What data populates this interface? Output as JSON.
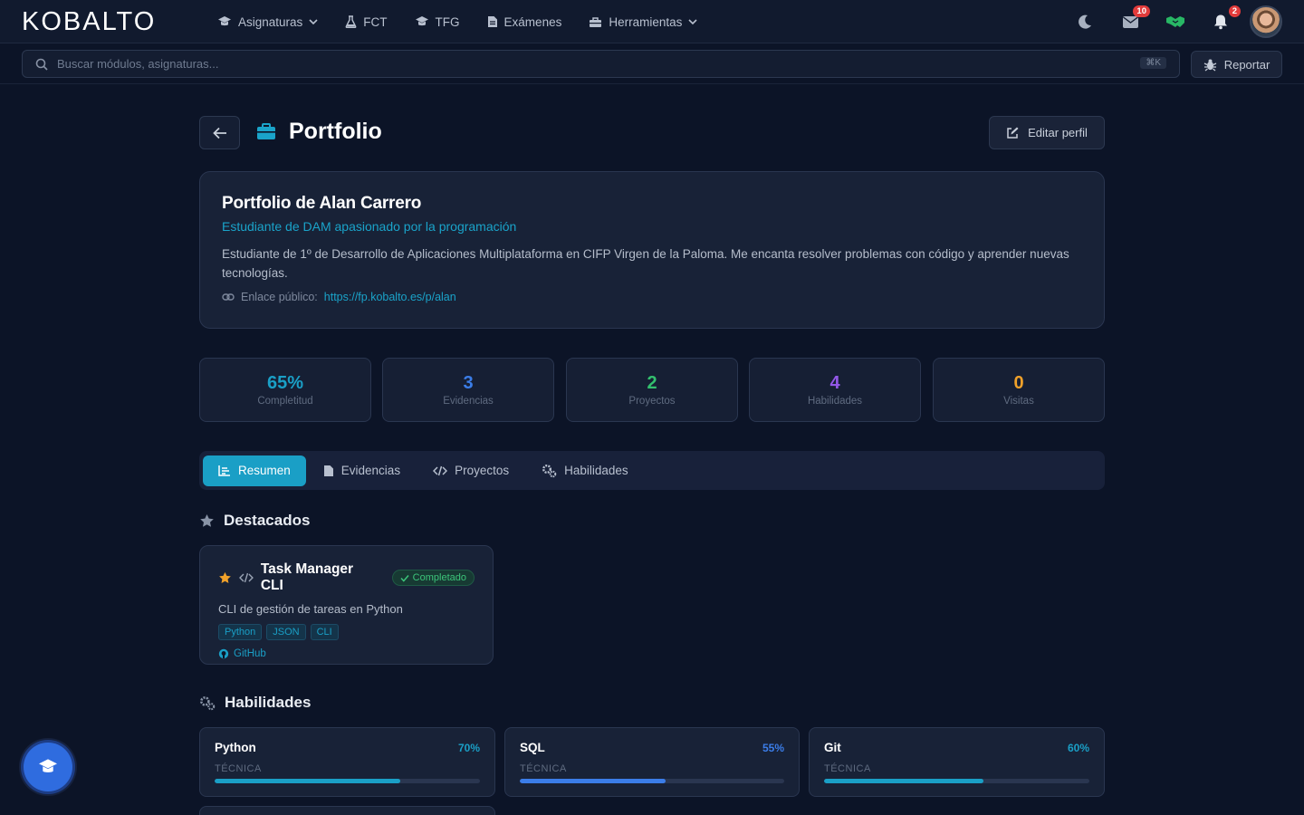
{
  "brand": {
    "logo": "KOBALTO"
  },
  "nav": [
    {
      "label": "Asignaturas",
      "icon": "graduation-cap-icon",
      "dropdown": true
    },
    {
      "label": "FCT",
      "icon": "flask-icon",
      "dropdown": false
    },
    {
      "label": "TFG",
      "icon": "graduation-cap-icon",
      "dropdown": false
    },
    {
      "label": "Exámenes",
      "icon": "file-icon",
      "dropdown": false
    },
    {
      "label": "Herramientas",
      "icon": "toolbox-icon",
      "dropdown": true
    }
  ],
  "topbar": {
    "messages_badge": "10",
    "notifications_badge": "2"
  },
  "search": {
    "placeholder": "Buscar módulos, asignaturas...",
    "shortcut": "⌘K",
    "report_label": "Reportar"
  },
  "page": {
    "title": "Portfolio",
    "edit_label": "Editar perfil"
  },
  "profile": {
    "name": "Portfolio de Alan Carrero",
    "tagline": "Estudiante de DAM apasionado por la programación",
    "bio": "Estudiante de 1º de Desarrollo de Aplicaciones Multiplataforma en CIFP Virgen de la Paloma. Me encanta resolver problemas con código y aprender nuevas tecnologías.",
    "link_label": "Enlace público:",
    "link_url": "https://fp.kobalto.es/p/alan"
  },
  "stats": [
    {
      "value": "65%",
      "label": "Completitud",
      "color": "#1a9fc6"
    },
    {
      "value": "3",
      "label": "Evidencias",
      "color": "#3b7de8"
    },
    {
      "value": "2",
      "label": "Proyectos",
      "color": "#33c06e"
    },
    {
      "value": "4",
      "label": "Habilidades",
      "color": "#9358e8"
    },
    {
      "value": "0",
      "label": "Visitas",
      "color": "#f0a12a"
    }
  ],
  "tabs": [
    {
      "label": "Resumen",
      "active": true
    },
    {
      "label": "Evidencias",
      "active": false
    },
    {
      "label": "Proyectos",
      "active": false
    },
    {
      "label": "Habilidades",
      "active": false
    }
  ],
  "featured": {
    "heading": "Destacados",
    "items": [
      {
        "title": "Task Manager CLI",
        "status": "Completado",
        "description": "CLI de gestión de tareas en Python",
        "tags": [
          "Python",
          "JSON",
          "CLI"
        ],
        "link_label": "GitHub"
      }
    ]
  },
  "skills": {
    "heading": "Habilidades",
    "items": [
      {
        "name": "Python",
        "percent_label": "70%",
        "level": 70,
        "category": "TÉCNICA",
        "color": "#1a9fc6"
      },
      {
        "name": "SQL",
        "percent_label": "55%",
        "level": 55,
        "category": "TÉCNICA",
        "color": "#3b7de8"
      },
      {
        "name": "Git",
        "percent_label": "60%",
        "level": 60,
        "category": "TÉCNICA",
        "color": "#1a9fc6"
      }
    ]
  }
}
